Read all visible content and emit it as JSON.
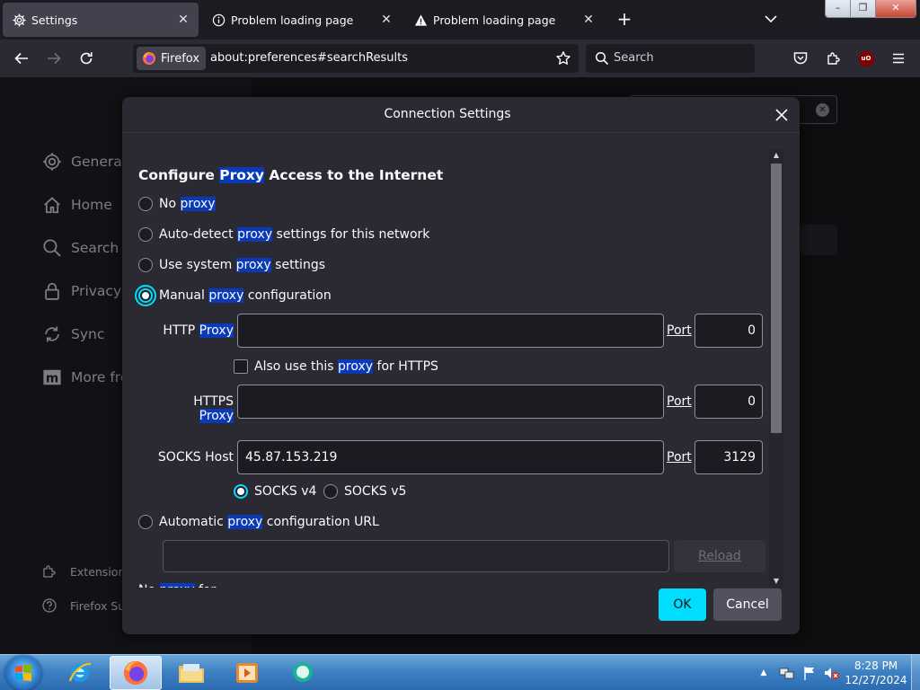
{
  "tabs": [
    {
      "title": "Settings",
      "icon": "gear-icon",
      "active": true
    },
    {
      "title": "Problem loading page",
      "icon": "info-icon",
      "active": false
    },
    {
      "title": "Problem loading page",
      "icon": "warning-icon",
      "active": false
    }
  ],
  "toolbar": {
    "identity_label": "Firefox",
    "url": "about:preferences#searchResults",
    "search_placeholder": "Search"
  },
  "settings_sidebar": {
    "items": [
      "General",
      "Home",
      "Search",
      "Privacy &",
      "Sync",
      "More fro"
    ],
    "footer": [
      "Extension",
      "Firefox Su"
    ]
  },
  "dialog": {
    "title": "Connection Settings",
    "section_title_pre": "Configure ",
    "section_title_hl": "Proxy",
    "section_title_post": " Access to the Internet",
    "options": {
      "no_proxy": {
        "pre": "No ",
        "hl": "proxy",
        "post": ""
      },
      "auto_detect": {
        "pre": "Auto-detect ",
        "hl": "proxy",
        "post": " settings for this network"
      },
      "system": {
        "pre": "Use system ",
        "hl": "proxy",
        "post": " settings"
      },
      "manual": {
        "pre": "Manual ",
        "hl": "proxy",
        "post": " configuration"
      },
      "auto_url": {
        "pre": "Automatic ",
        "hl": "proxy",
        "post": " configuration URL"
      }
    },
    "selected_option": "manual",
    "http": {
      "label_pre": "HTTP ",
      "label_hl": "Proxy",
      "value": "",
      "port_label": "Port",
      "port": "0"
    },
    "also_https": {
      "pre": "Also use this ",
      "hl": "proxy",
      "post": " for HTTPS",
      "checked": false
    },
    "https": {
      "label_pre": "HTTPS ",
      "label_hl": "Proxy",
      "value": "",
      "port_label": "Port",
      "port": "0"
    },
    "socks": {
      "label": "SOCKS Host",
      "value": "45.87.153.219",
      "port_label": "Port",
      "port": "3129"
    },
    "socks_v4": "SOCKS v4",
    "socks_v5": "SOCKS v5",
    "socks_version": "v4",
    "pac_url": "",
    "reload_label": "Reload",
    "cut_off_pre": "No ",
    "cut_off_hl": "proxy",
    "cut_off_post": " for",
    "ok_label": "OK",
    "cancel_label": "Cancel"
  },
  "taskbar": {
    "apps": [
      "internet-explorer",
      "firefox",
      "file-explorer",
      "media-player",
      "chat-app"
    ],
    "active_app": "firefox",
    "time": "8:28 PM",
    "date": "12/27/2024"
  },
  "colors": {
    "accent": "#00ddff",
    "highlight": "#0a3ab8",
    "dialog_bg": "#2b2a33",
    "field_bg": "#1c1b22"
  }
}
